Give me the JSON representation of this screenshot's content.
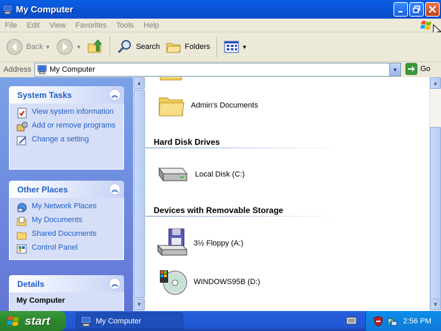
{
  "window": {
    "title": "My Computer"
  },
  "menu": {
    "items": [
      "File",
      "Edit",
      "View",
      "Favorites",
      "Tools",
      "Help"
    ]
  },
  "toolbar": {
    "back": "Back",
    "search": "Search",
    "folders": "Folders"
  },
  "address": {
    "label": "Address",
    "value": "My Computer",
    "go": "Go"
  },
  "task_pane": {
    "system_tasks": {
      "title": "System Tasks",
      "items": [
        "View system information",
        "Add or remove programs",
        "Change a setting"
      ]
    },
    "other_places": {
      "title": "Other Places",
      "items": [
        "My Network Places",
        "My Documents",
        "Shared Documents",
        "Control Panel"
      ]
    },
    "details": {
      "title": "Details",
      "name": "My Computer"
    }
  },
  "content": {
    "folder_item": "Admin's Documents",
    "hard_disk": {
      "header": "Hard Disk Drives",
      "items": [
        "Local Disk (C:)"
      ]
    },
    "removable": {
      "header": "Devices with Removable Storage",
      "items": [
        "3½ Floppy (A:)",
        "WINDOWS95B (D:)"
      ]
    }
  },
  "taskbar": {
    "start": "start",
    "task": "My Computer",
    "clock": "2:56 PM"
  }
}
